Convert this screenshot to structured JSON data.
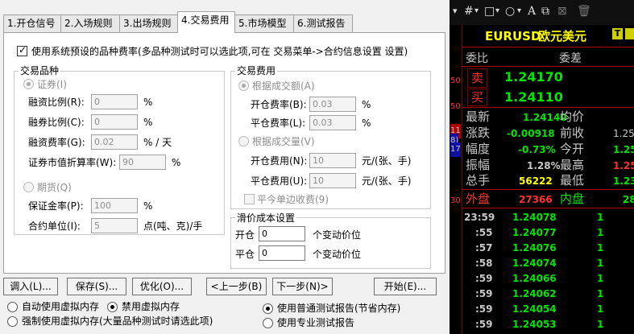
{
  "tabs": [
    "1.开仓信号",
    "2.入场规则",
    "3.出场规则",
    "4.交易费用",
    "5.市场模型",
    "6.测试报告"
  ],
  "use_default_fees": "使用系统预设的品种费率(多品种测试时可以选此项,可在 交易菜单->合约信息设置 设置)",
  "product_group": {
    "title": "交易品种",
    "securities": "证券(I)",
    "margin_ratio_label": "融资比例(R):",
    "margin_ratio_value": "0",
    "margin_ratio_unit": "%",
    "short_ratio_label": "融券比例(C):",
    "short_ratio_value": "0",
    "short_ratio_unit": "%",
    "margin_rate_label": "融资费率(G):",
    "margin_rate_value": "0.02",
    "margin_rate_unit": "% / 天",
    "discount_label": "证券市值折算率(W):",
    "discount_value": "90",
    "discount_unit": "%",
    "futures": "期货(Q)",
    "deposit_label": "保证金率(P):",
    "deposit_value": "100",
    "deposit_unit": "%",
    "contract_unit_label": "合约单位(I):",
    "contract_unit_value": "5",
    "contract_unit_unit": "点(吨、克)/手"
  },
  "fee_group": {
    "title": "交易费用",
    "by_amount": "根据成交额(A)",
    "open_rate_label": "开仓费率(B):",
    "open_rate_value": "0.03",
    "open_rate_unit": "%",
    "close_rate_label": "平仓费率(L):",
    "close_rate_value": "0.03",
    "close_rate_unit": "%",
    "by_volume": "根据成交量(V)",
    "open_fee_label": "开仓费用(N):",
    "open_fee_value": "10",
    "open_fee_unit": "元/(张、手)",
    "close_fee_label": "平仓费用(U):",
    "close_fee_value": "10",
    "close_fee_unit": "元/(张、手)",
    "today_close": "平今单边收费(9)"
  },
  "slippage": {
    "title": "滑价成本设置",
    "open_label": "开仓",
    "open_value": "0",
    "open_unit": "个变动价位",
    "close_label": "平仓",
    "close_value": "0",
    "close_unit": "个变动价位"
  },
  "buttons": {
    "load": "调入(L)...",
    "save": "保存(S)...",
    "optimize": "优化(O)...",
    "prev": "<上一步(B)",
    "next": "下一步(N)>",
    "start": "开始(E)..."
  },
  "memory_options": {
    "auto": "自动使用虚拟内存",
    "disable": "禁用虚拟内存",
    "force": "强制使用虚拟内存(大量品种测试时请选此项)"
  },
  "report_options": {
    "normal": "使用普通测试报告(节省内存)",
    "pro": "使用专业测试报告"
  },
  "toolbar_icons": [
    "grid-icon",
    "rectangle-icon",
    "circle-icon",
    "text-icon",
    "copy-icon",
    "delete-icon",
    "trash-icon"
  ],
  "quote": {
    "symbol": "EURUSD",
    "name": "欧元美元",
    "badge": "T",
    "weibi": "委比",
    "weicha": "委差",
    "sell_label": "卖",
    "sell_price": "1.24170",
    "buy_label": "买",
    "buy_price": "1.24110",
    "side_nums": [
      "50",
      "50",
      "11",
      "8)",
      "17",
      "30"
    ],
    "rows": [
      {
        "l": "最新",
        "v": "1.24140",
        "l2": "均价",
        "v2": ""
      },
      {
        "l": "涨跌",
        "v": "-0.00918",
        "l2": "前收",
        "v2": "1.25"
      },
      {
        "l": "幅度",
        "v": "-0.73%",
        "l2": "今开",
        "v2": "1.25"
      },
      {
        "l": "振幅",
        "v": "1.28%",
        "l2": "最高",
        "v2": "1.25"
      },
      {
        "l": "总手",
        "v": "56222",
        "l2": "最低",
        "v2": "1.23"
      }
    ],
    "outer_label": "外盘",
    "outer_value": "27366",
    "inner_label": "内盘",
    "inner_value": "28",
    "ticks": [
      {
        "t": "23:59",
        "p": "1.24078",
        "v": "1"
      },
      {
        "t": ":55",
        "p": "1.24077",
        "v": "1"
      },
      {
        "t": ":57",
        "p": "1.24076",
        "v": "1"
      },
      {
        "t": ":58",
        "p": "1.24074",
        "v": "1"
      },
      {
        "t": ":59",
        "p": "1.24066",
        "v": "1"
      },
      {
        "t": ":59",
        "p": "1.24062",
        "v": "1"
      },
      {
        "t": ":59",
        "p": "1.24054",
        "v": "1"
      },
      {
        "t": ":59",
        "p": "1.24053",
        "v": "1"
      }
    ]
  }
}
